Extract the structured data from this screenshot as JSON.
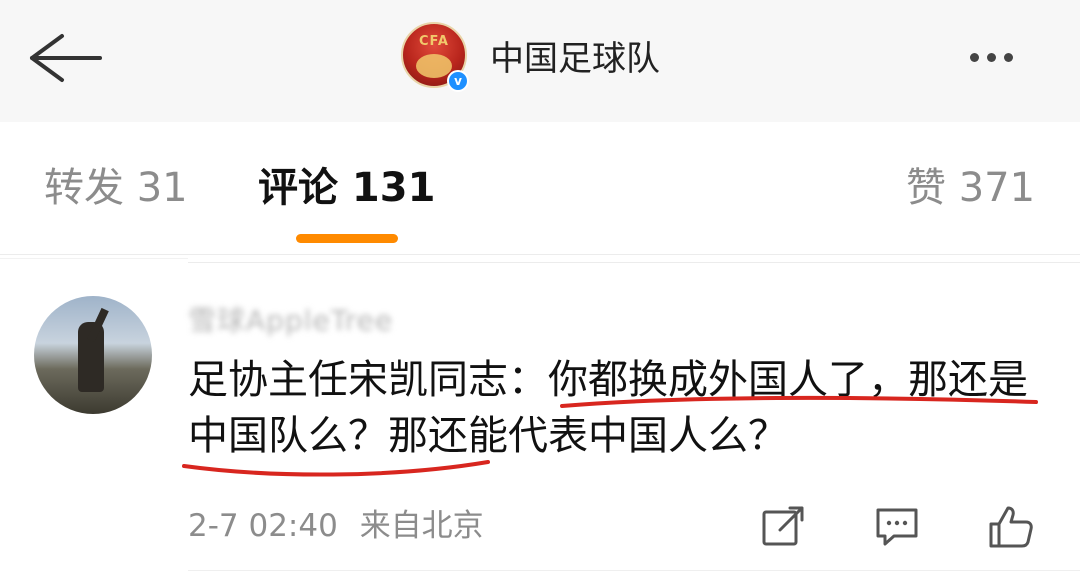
{
  "header": {
    "account_name": "中国足球队",
    "avatar_text": "CFA",
    "verified": true
  },
  "tabs": [
    {
      "label": "转发 31",
      "active": false
    },
    {
      "label": "评论 131",
      "active": true
    },
    {
      "label": "赞 371",
      "active": false
    }
  ],
  "comment": {
    "username": "雪球AppleTree",
    "text": "足协主任宋凯同志：你都换成外国人了，那还是中国队么？那还能代表中国人么？",
    "timestamp": "2-7 02:40",
    "location": "来自北京",
    "underline_color": "#d8261f"
  },
  "icons": {
    "back": "back-arrow-icon",
    "more": "more-dots-icon",
    "share": "share-icon",
    "reply": "comment-icon",
    "like": "thumbs-up-icon"
  },
  "colors": {
    "accent": "#ff8a00",
    "verified": "#1e90ff"
  }
}
